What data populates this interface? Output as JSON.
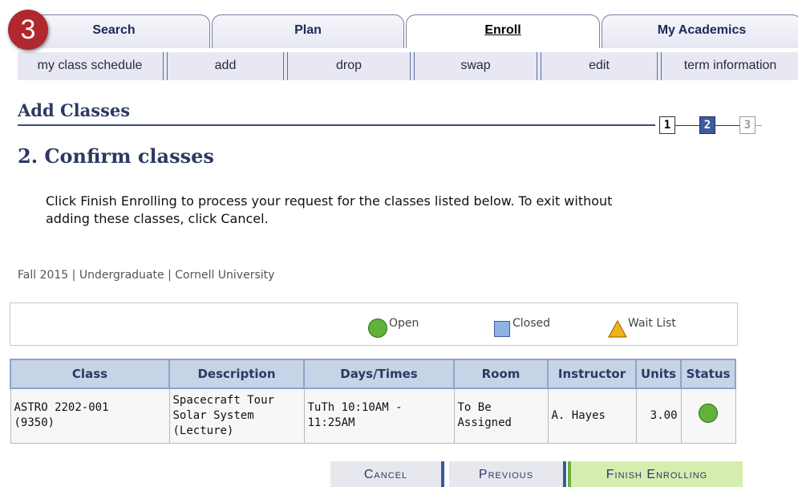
{
  "step_badge": "3",
  "tabs": [
    {
      "label": "Search"
    },
    {
      "label": "Plan"
    },
    {
      "label": "Enroll"
    },
    {
      "label": "My Academics"
    }
  ],
  "subtabs": [
    {
      "label": "my class schedule"
    },
    {
      "label": "add"
    },
    {
      "label": "drop"
    },
    {
      "label": "swap"
    },
    {
      "label": "edit"
    },
    {
      "label": "term information"
    }
  ],
  "page_title": "Add Classes",
  "steps": [
    "1",
    "2",
    "3"
  ],
  "section_title": "2.  Confirm classes",
  "instructions": "Click Finish Enrolling to process your request for the classes listed below. To exit without adding these classes, click Cancel.",
  "term_info": "Fall 2015 | Undergraduate | Cornell University",
  "legend": {
    "open": "Open",
    "closed": "Closed",
    "wait_list": "Wait List"
  },
  "table": {
    "headers": [
      "Class",
      "Description",
      "Days/Times",
      "Room",
      "Instructor",
      "Units",
      "Status"
    ],
    "rows": [
      {
        "class_line1": "ASTRO 2202-001",
        "class_line2": "(9350)",
        "desc_line1": "Spacecraft Tour",
        "desc_line2": "Solar System",
        "desc_line3": "(Lecture)",
        "time_line1": "TuTh 10:10AM -",
        "time_line2": "11:25AM",
        "room_line1": "To Be",
        "room_line2": "Assigned",
        "instructor": "A. Hayes",
        "units": "3.00",
        "status": "open"
      }
    ]
  },
  "buttons": {
    "cancel": "Cancel",
    "previous": "Previous",
    "finish": "Finish Enrolling"
  },
  "colors": {
    "accent": "#2c3a62",
    "open": "#5fb33a",
    "closed": "#8fb2e6",
    "wait_list": "#f2b21c",
    "badge": "#b0272d"
  }
}
